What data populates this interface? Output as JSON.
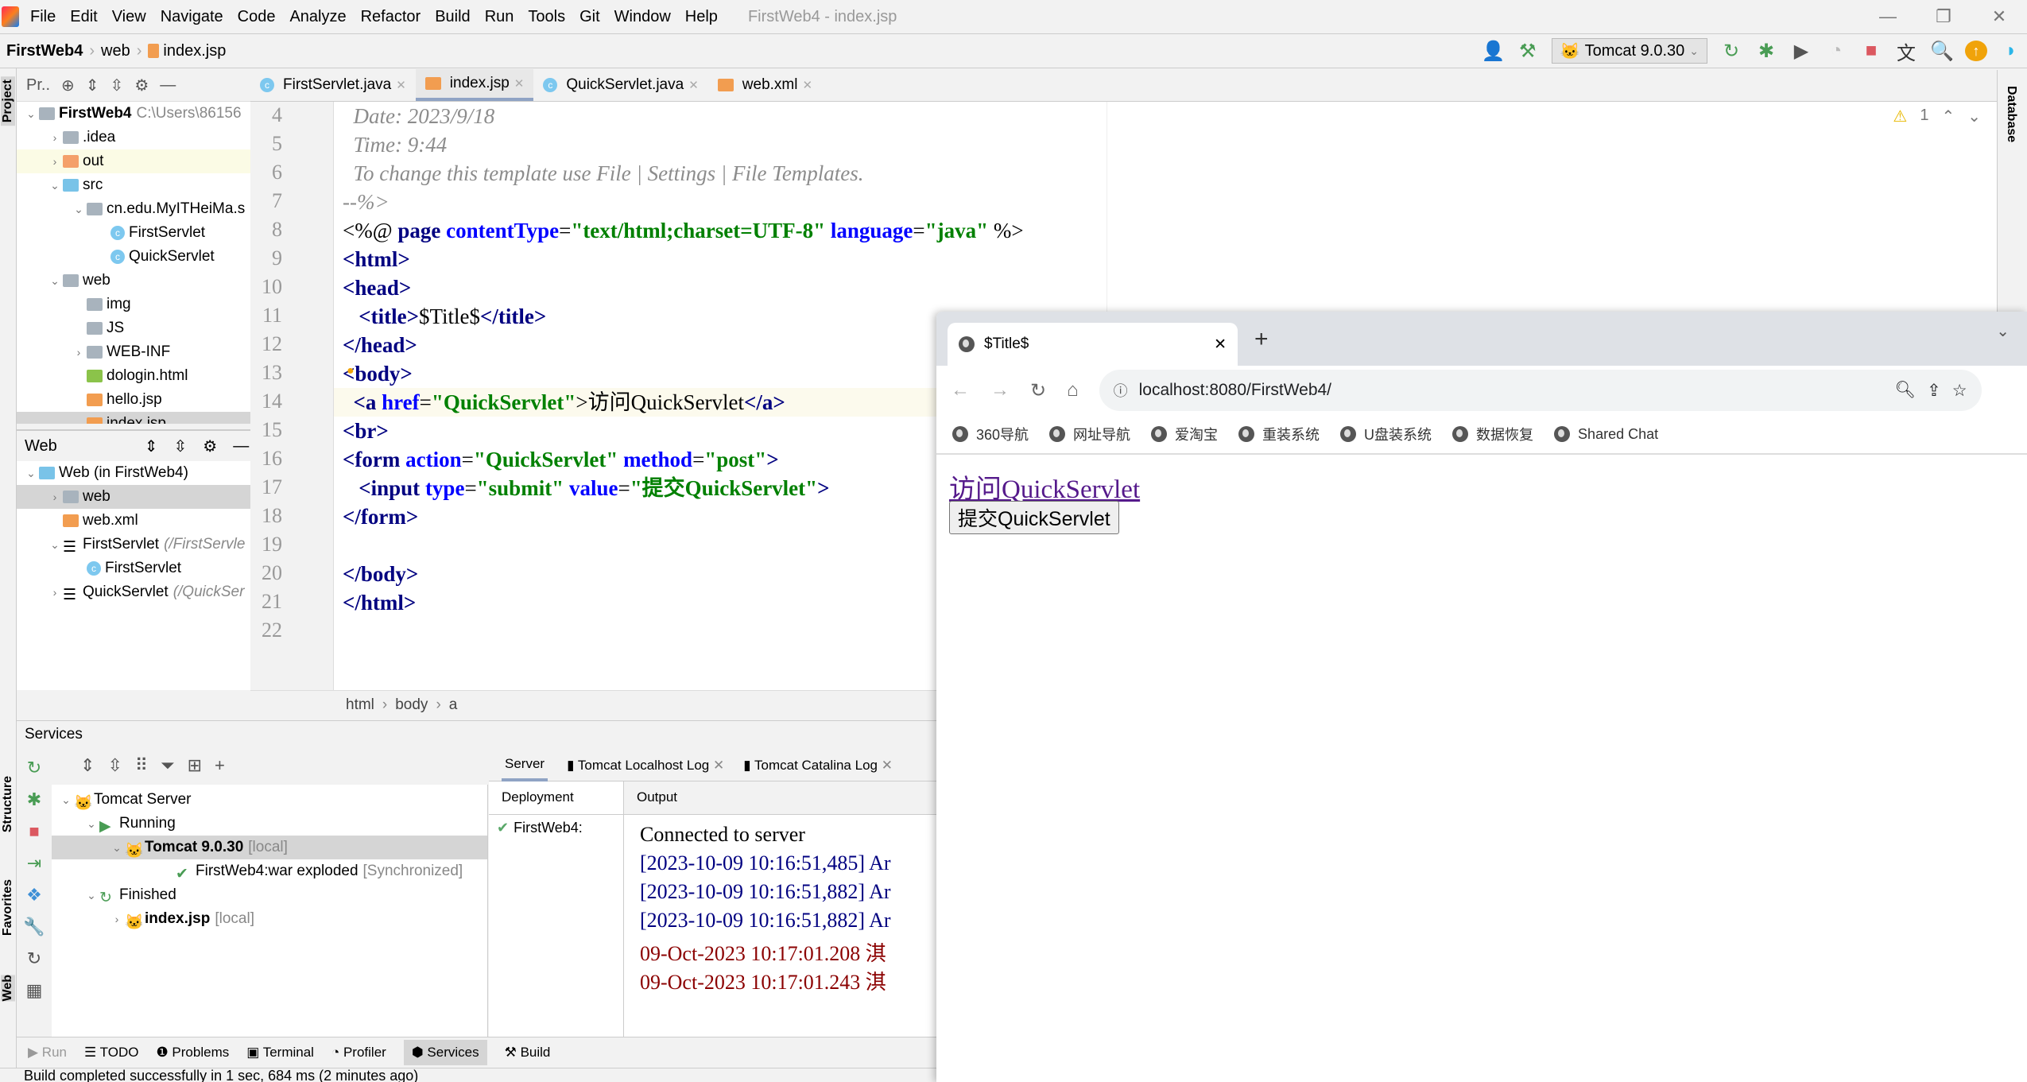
{
  "menu": {
    "items": [
      "File",
      "Edit",
      "View",
      "Navigate",
      "Code",
      "Analyze",
      "Refactor",
      "Build",
      "Run",
      "Tools",
      "Git",
      "Window",
      "Help"
    ],
    "window_title": "FirstWeb4 - index.jsp"
  },
  "nav": {
    "crumbs": [
      "FirstWeb4",
      "web",
      "index.jsp"
    ]
  },
  "toolbar": {
    "run_config": "Tomcat 9.0.30"
  },
  "project": {
    "tab": "Pr..",
    "tree": [
      {
        "label": "FirstWeb4",
        "extra": "C:\\Users\\86156",
        "depth": 0,
        "arrow": "v",
        "icon": "module",
        "bold": true
      },
      {
        "label": ".idea",
        "depth": 1,
        "arrow": ">",
        "icon": "folder"
      },
      {
        "label": "out",
        "depth": 1,
        "arrow": ">",
        "icon": "folder-orange",
        "hl": true
      },
      {
        "label": "src",
        "depth": 1,
        "arrow": "v",
        "icon": "folder-blue"
      },
      {
        "label": "cn.edu.MyITHeiMa.s",
        "depth": 2,
        "arrow": "v",
        "icon": "package"
      },
      {
        "label": "FirstServlet",
        "depth": 3,
        "icon": "class"
      },
      {
        "label": "QuickServlet",
        "depth": 3,
        "icon": "class"
      },
      {
        "label": "web",
        "depth": 1,
        "arrow": "v",
        "icon": "folder-web"
      },
      {
        "label": "img",
        "depth": 2,
        "icon": "folder"
      },
      {
        "label": "JS",
        "depth": 2,
        "icon": "folder"
      },
      {
        "label": "WEB-INF",
        "depth": 2,
        "arrow": ">",
        "icon": "folder"
      },
      {
        "label": "dologin.html",
        "depth": 2,
        "icon": "html"
      },
      {
        "label": "hello.jsp",
        "depth": 2,
        "icon": "jsp"
      },
      {
        "label": "index.jsp",
        "depth": 2,
        "icon": "jsp",
        "sel": true
      }
    ]
  },
  "web_panel": {
    "title": "Web",
    "tree": [
      {
        "label": "Web (in FirstWeb4)",
        "depth": 0,
        "arrow": "v",
        "icon": "web"
      },
      {
        "label": "web",
        "depth": 1,
        "arrow": ">",
        "icon": "folder-web",
        "sel": true
      },
      {
        "label": "web.xml",
        "depth": 1,
        "icon": "xml"
      },
      {
        "label": "FirstServlet",
        "extra": "(/FirstServle",
        "depth": 1,
        "arrow": "v",
        "icon": "servlet"
      },
      {
        "label": "FirstServlet",
        "depth": 2,
        "icon": "class"
      },
      {
        "label": "QuickServlet",
        "extra": "(/QuickSer",
        "depth": 1,
        "arrow": ">",
        "icon": "servlet"
      }
    ]
  },
  "editor": {
    "tabs": [
      {
        "label": "FirstServlet.java",
        "icon": "class"
      },
      {
        "label": "index.jsp",
        "icon": "jsp",
        "active": true
      },
      {
        "label": "QuickServlet.java",
        "icon": "class"
      },
      {
        "label": "web.xml",
        "icon": "xml"
      }
    ],
    "lines": [
      {
        "n": "4",
        "tokens": [
          [
            "  Date: 2023/9/18",
            "c"
          ]
        ]
      },
      {
        "n": "5",
        "tokens": [
          [
            "  Time: 9:44",
            "c"
          ]
        ]
      },
      {
        "n": "6",
        "tokens": [
          [
            "  To change this template use File | Settings | File Templates.",
            "c"
          ]
        ]
      },
      {
        "n": "7",
        "tokens": [
          [
            "--%>",
            "c"
          ]
        ]
      },
      {
        "n": "8",
        "tokens": [
          [
            "<%@ ",
            "p"
          ],
          [
            "page ",
            "t"
          ],
          [
            "contentType",
            "a"
          ],
          [
            "=",
            "p"
          ],
          [
            "\"text/html;charset=UTF-8\"",
            "s"
          ],
          [
            " language",
            "a"
          ],
          [
            "=",
            "p"
          ],
          [
            "\"java\"",
            "s"
          ],
          [
            " %>",
            "p"
          ]
        ]
      },
      {
        "n": "9",
        "tokens": [
          [
            "<html>",
            "t"
          ]
        ]
      },
      {
        "n": "10",
        "tokens": [
          [
            "<head>",
            "t"
          ]
        ]
      },
      {
        "n": "11",
        "tokens": [
          [
            "   <title>",
            "t"
          ],
          [
            "$Title$",
            "p"
          ],
          [
            "</title>",
            "t"
          ]
        ]
      },
      {
        "n": "12",
        "tokens": [
          [
            "</head>",
            "t"
          ]
        ]
      },
      {
        "n": "13",
        "tokens": [
          [
            "<body>",
            "t"
          ]
        ]
      },
      {
        "n": "14",
        "tokens": [
          [
            "  <a ",
            "t"
          ],
          [
            "href",
            "a"
          ],
          [
            "=",
            "p"
          ],
          [
            "\"QuickServlet\"",
            "s"
          ],
          [
            ">访问QuickServlet",
            "p"
          ],
          [
            "</a>",
            "t"
          ]
        ],
        "current": true
      },
      {
        "n": "15",
        "tokens": [
          [
            "<br>",
            "t"
          ]
        ]
      },
      {
        "n": "16",
        "tokens": [
          [
            "<form ",
            "t"
          ],
          [
            "action",
            "a"
          ],
          [
            "=",
            "p"
          ],
          [
            "\"QuickServlet\"",
            "s"
          ],
          [
            " method",
            "a"
          ],
          [
            "=",
            "p"
          ],
          [
            "\"post\"",
            "s"
          ],
          [
            ">",
            "t"
          ]
        ]
      },
      {
        "n": "17",
        "tokens": [
          [
            "   <input ",
            "t"
          ],
          [
            "type",
            "a"
          ],
          [
            "=",
            "p"
          ],
          [
            "\"submit\"",
            "s"
          ],
          [
            " value",
            "a"
          ],
          [
            "=",
            "p"
          ],
          [
            "\"提交QuickServlet\"",
            "s"
          ],
          [
            ">",
            "t"
          ]
        ]
      },
      {
        "n": "18",
        "tokens": [
          [
            "</form>",
            "t"
          ]
        ]
      },
      {
        "n": "19",
        "tokens": []
      },
      {
        "n": "20",
        "tokens": [
          [
            "</body>",
            "t"
          ]
        ]
      },
      {
        "n": "21",
        "tokens": [
          [
            "</html>",
            "t"
          ]
        ]
      },
      {
        "n": "22",
        "tokens": []
      }
    ],
    "warnings": "1",
    "breadcrumb": [
      "html",
      "body",
      "a"
    ]
  },
  "services": {
    "title": "Services",
    "tree": [
      {
        "label": "Tomcat Server",
        "depth": 0,
        "arrow": "v",
        "icon": "tomcat"
      },
      {
        "label": "Running",
        "depth": 1,
        "arrow": "v",
        "icon": "run"
      },
      {
        "label": "Tomcat 9.0.30",
        "extra": "[local]",
        "depth": 2,
        "arrow": "v",
        "icon": "tomcat",
        "bold": true,
        "sel": true
      },
      {
        "label": "FirstWeb4:war exploded",
        "extra": "[Synchronized]",
        "depth": 4,
        "icon": "artifact"
      },
      {
        "label": "Finished",
        "depth": 1,
        "arrow": "v",
        "icon": "rerun"
      },
      {
        "label": "index.jsp",
        "extra": "[local]",
        "depth": 2,
        "arrow": ">",
        "icon": "tomcat",
        "bold": true
      }
    ],
    "tabs": [
      "Server",
      "Tomcat Localhost Log",
      "Tomcat Catalina Log"
    ],
    "deployment_header": "Deployment",
    "output_header": "Output",
    "deployment_item": "FirstWeb4:",
    "output": [
      {
        "text": "Connected to server",
        "color": "#000000"
      },
      {
        "text": "[2023-10-09 10:16:51,485] Ar",
        "color": "#000080"
      },
      {
        "text": "[2023-10-09 10:16:51,882] Ar",
        "color": "#000080"
      },
      {
        "text": "[2023-10-09 10:16:51,882] Ar",
        "color": "#000080"
      },
      {
        "text": "09-Oct-2023 10:17:01.208 淇",
        "color": "#8b0000"
      },
      {
        "text": "09-Oct-2023 10:17:01.243 淇",
        "color": "#8b0000"
      }
    ]
  },
  "bottom": {
    "tools": [
      "Run",
      "TODO",
      "Problems",
      "Terminal",
      "Profiler",
      "Services",
      "Build"
    ],
    "active": "Services",
    "status": "Build completed successfully in 1 sec, 684 ms (2 minutes ago)"
  },
  "side": {
    "left": [
      "Project",
      "Structure",
      "Favorites",
      "Web"
    ],
    "right": [
      "Database"
    ]
  },
  "browser": {
    "tab_title": "$Title$",
    "url": "localhost:8080/FirstWeb4/",
    "bookmarks": [
      "360导航",
      "网址导航",
      "爱淘宝",
      "重装系统",
      "U盘装系统",
      "数据恢复",
      "Shared Chat"
    ],
    "page": {
      "link": "访问QuickServlet",
      "button": "提交QuickServlet"
    }
  }
}
